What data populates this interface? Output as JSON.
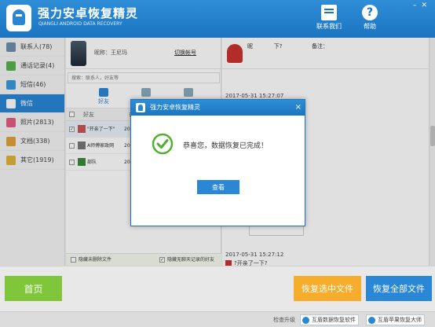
{
  "header": {
    "title": "强力安卓恢复精灵",
    "subtitle": "QIANGLI ANDROID DATA RECOVERY",
    "contact_label": "联系我们",
    "help_label": "帮助"
  },
  "sidebar": {
    "items": [
      {
        "label": "联系人(78)",
        "color": "#6f8fb0"
      },
      {
        "label": "通话记录(4)",
        "color": "#57b24a"
      },
      {
        "label": "短信(46)",
        "color": "#3a9ad9"
      },
      {
        "label": "微信",
        "color": "#ffffff"
      },
      {
        "label": "照片(2813)",
        "color": "#e25f84"
      },
      {
        "label": "文档(338)",
        "color": "#e2a23a"
      },
      {
        "label": "其它(1919)",
        "color": "#e0b43a"
      }
    ]
  },
  "phone": {
    "nickname": "昵称：王尼玛",
    "switch_account": "切换帐号",
    "search_placeholder": "搜索：联系人，好友等",
    "tabs": [
      {
        "label": "好友"
      },
      {
        "label": ""
      },
      {
        "label": ""
      }
    ],
    "header_friend": "好友",
    "header_count": "条",
    "rows": [
      {
        "name": "\"开亲了一下\"",
        "year": "201",
        "checked": "✓"
      },
      {
        "name": "A师傅家政网",
        "year": "201",
        "checked": ""
      },
      {
        "name": "部队",
        "year": "201",
        "checked": ""
      }
    ],
    "footer_hide_recover": "隐藏未删除文件",
    "footer_hide_empty": "隐藏无聊天记录的好友",
    "hide_empty_checked": "✓"
  },
  "chat": {
    "nickname": "昵",
    "nick_suffix": "下?",
    "remark": "备注：",
    "timestamps": [
      "2017-05-31 15:27:07",
      "2017-05-31 15:27:12"
    ],
    "line2_text": "?开亲了一下?"
  },
  "bottom": {
    "home": "首页",
    "recover_selected": "恢复选中文件",
    "recover_all": "恢复全部文件"
  },
  "status": {
    "check_update": "检查升级",
    "ad_android": "互盾数据恢复软件",
    "ad_apple": "互盾苹果恢复大师"
  },
  "modal": {
    "title": "强力安卓恢复精灵",
    "close": "×",
    "message": "恭喜您，数据恢复已完成！",
    "view_button": "查看"
  },
  "colors": {
    "accent": "#2a87d6",
    "success": "#52b02e",
    "home_button": "#7fc63a",
    "recover_selected_button": "#f6ad2c"
  }
}
